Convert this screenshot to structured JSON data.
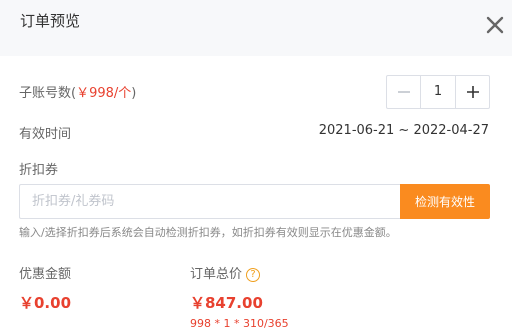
{
  "header": {
    "title": "订单预览"
  },
  "subaccount": {
    "label": "子账号数",
    "paren_open": "(",
    "unit_price": "￥998/个",
    "paren_close": ")",
    "quantity": "1",
    "minus_icon": "minus-icon",
    "plus_icon": "plus-icon"
  },
  "validity": {
    "label": "有效时间",
    "value": "2021-06-21 ~ 2022-04-27"
  },
  "coupon": {
    "label": "折扣券",
    "placeholder": "折扣券/礼券码",
    "value": "",
    "button_label": "检测有效性",
    "hint": "输入/选择折扣券后系统会自动检测折扣券，如折扣券有效则显示在优惠金额。"
  },
  "summary": {
    "discount_label": "优惠金额",
    "discount_value": "￥0.00",
    "total_label": "订单总价",
    "total_value": "￥847.00",
    "formula": "998 * 1 * 310/365",
    "help_icon": "question-circle-icon",
    "help_glyph": "?"
  },
  "colors": {
    "accent_orange": "#fa8b1f",
    "price_red": "#e8412f",
    "header_bg": "#f7f8fa"
  }
}
